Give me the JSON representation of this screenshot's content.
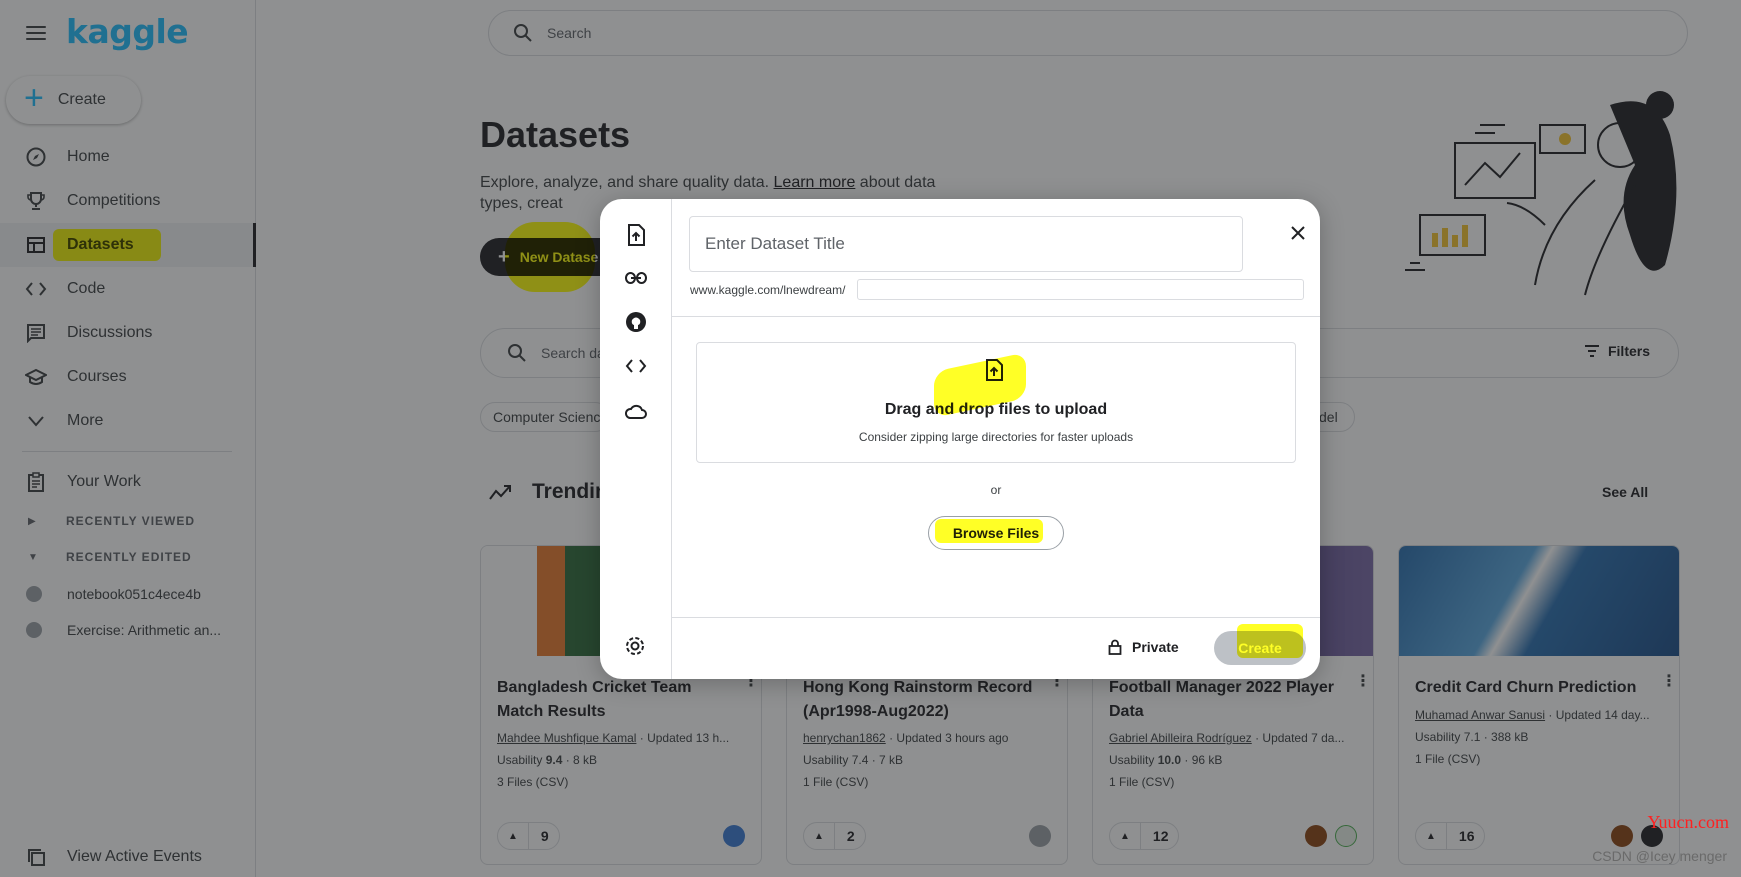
{
  "app": {
    "logo": "kaggle",
    "create_label": "Create",
    "search_placeholder": "Search"
  },
  "sidebar": {
    "items": [
      {
        "label": "Home",
        "icon": "compass-icon"
      },
      {
        "label": "Competitions",
        "icon": "trophy-icon"
      },
      {
        "label": "Datasets",
        "icon": "table-icon",
        "active": true
      },
      {
        "label": "Code",
        "icon": "code-icon"
      },
      {
        "label": "Discussions",
        "icon": "discussion-icon"
      },
      {
        "label": "Courses",
        "icon": "school-icon"
      },
      {
        "label": "More",
        "icon": "chevron-down-icon"
      }
    ],
    "your_work": "Your Work",
    "recently_viewed": "RECENTLY VIEWED",
    "recently_edited": "RECENTLY EDITED",
    "recent_items": [
      "notebook051c4ece4b",
      "Exercise: Arithmetic an..."
    ],
    "view_active_events": "View Active Events"
  },
  "main": {
    "title": "Datasets",
    "description_prefix": "Explore, analyze, and share quality data. ",
    "learn_more": "Learn more",
    "description_suffix": " about data types, creat",
    "new_dataset": "New Datase",
    "search_placeholder": "Search da",
    "filters": "Filters",
    "chips": [
      "Computer Scienc",
      "del"
    ],
    "trending_title": "Trendin",
    "see_all": "See All",
    "cards": [
      {
        "title": "Bangladesh Cricket Team Match Results",
        "author": "Mahdee Mushfique Kamal",
        "updated": " · Updated 13 h...",
        "usability_label": "Usability ",
        "usability": "9.4",
        "size": " · 8 kB",
        "files": "3 Files (CSV)",
        "votes": "9",
        "thumb_color": "#2e6b3a"
      },
      {
        "title": "Hong Kong Rainstorm Record (Apr1998-Aug2022)",
        "author": "henrychan1862",
        "updated": " · Updated 3 hours ago",
        "usability_label": "Usability ",
        "usability": "7.4",
        "size": " · 7 kB",
        "files": "1 File (CSV)",
        "votes": "2",
        "thumb_color": "#ffffff"
      },
      {
        "title": "Football Manager 2022 Player Data",
        "author": "Gabriel Abilleira Rodríguez",
        "updated": " · Updated 7 da...",
        "usability_label": "Usability ",
        "usability": "10.0",
        "size": " · 96 kB",
        "files": "1 File (CSV)",
        "votes": "12",
        "thumb_color": "#3b3470"
      },
      {
        "title": "Credit Card Churn Prediction",
        "author": "Muhamad Anwar Sanusi",
        "updated": " · Updated 14 day...",
        "usability_label": "Usability ",
        "usability": "7.1",
        "size": " · 388 kB",
        "files": "1 File (CSV)",
        "votes": "16",
        "thumb_color": "#2a6fb0"
      }
    ]
  },
  "modal": {
    "title_placeholder": "Enter Dataset Title",
    "url_prefix": "www.kaggle.com/lnewdream/",
    "drop_title": "Drag and drop files to upload",
    "drop_sub": "Consider zipping large directories for faster uploads",
    "or": "or",
    "browse": "Browse Files",
    "private": "Private",
    "create": "Create",
    "rail_icons": [
      "upload-file-icon",
      "link-icon",
      "github-icon",
      "code-icon",
      "cloud-icon"
    ]
  },
  "watermark": {
    "site": "Yuucn.com",
    "author": "CSDN @Icey menger"
  }
}
